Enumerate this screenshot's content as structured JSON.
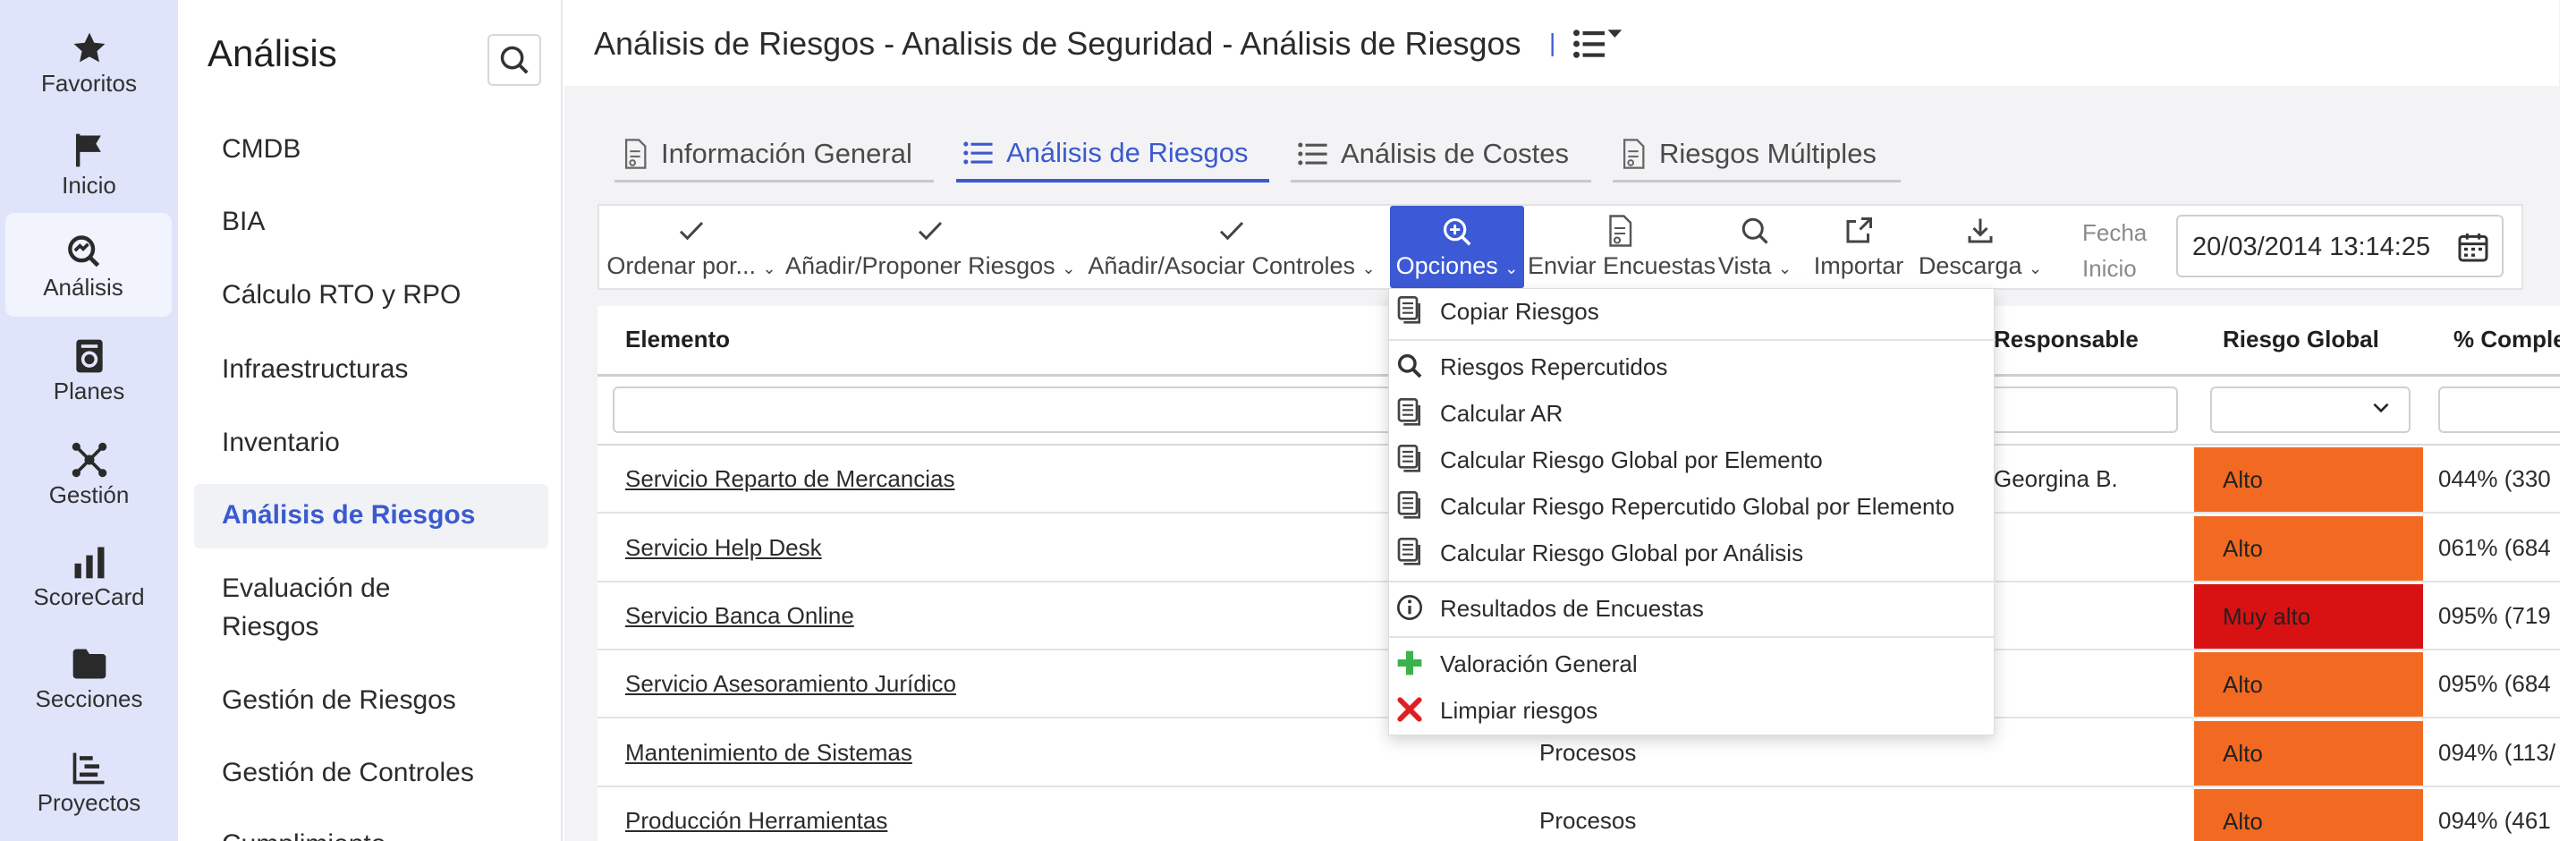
{
  "rail": {
    "items": [
      {
        "label": "Favoritos",
        "icon": "star-icon"
      },
      {
        "label": "Inicio",
        "icon": "flag-icon"
      },
      {
        "label": "Análisis",
        "icon": "analysis-icon",
        "active": true
      },
      {
        "label": "Planes",
        "icon": "plans-icon"
      },
      {
        "label": "Gestión",
        "icon": "network-icon"
      },
      {
        "label": "ScoreCard",
        "icon": "bar-chart-icon"
      },
      {
        "label": "Secciones",
        "icon": "folder-icon"
      },
      {
        "label": "Proyectos",
        "icon": "gantt-icon"
      }
    ]
  },
  "leftnav": {
    "title": "Análisis",
    "items": [
      "CMDB",
      "BIA",
      "Cálculo RTO y RPO",
      "Infraestructuras",
      "Inventario",
      "Análisis de Riesgos",
      "Evaluación de",
      "Riesgos",
      "Gestión de Riesgos",
      "Gestión de Controles",
      "Cumplimiento"
    ],
    "active": "Análisis de Riesgos"
  },
  "header": {
    "title": "Análisis de Riesgos  - Analisis de Seguridad - Análisis de Riesgos",
    "separator": "|"
  },
  "tabs": [
    {
      "label": "Información General",
      "icon": "document-icon"
    },
    {
      "label": "Análisis de Riesgos",
      "icon": "list-icon",
      "active": true
    },
    {
      "label": "Análisis de Costes",
      "icon": "list-icon"
    },
    {
      "label": "Riesgos Múltiples",
      "icon": "document-icon"
    }
  ],
  "toolbar": {
    "buttons": [
      {
        "label": "Ordenar por...",
        "icon": "check-icon"
      },
      {
        "label": "Añadir/Proponer Riesgos",
        "icon": "check-icon"
      },
      {
        "label": "Añadir/Asociar Controles",
        "icon": "check-icon"
      },
      {
        "label": "Opciones",
        "icon": "zoom-in-icon",
        "active": true
      },
      {
        "label": "Enviar Encuestas",
        "icon": "survey-icon"
      },
      {
        "label": "Vista",
        "icon": "search-icon"
      },
      {
        "label": "Importar",
        "icon": "import-icon"
      },
      {
        "label": "Descarga",
        "icon": "download-icon"
      }
    ],
    "fecha_label_1": "Fecha",
    "fecha_label_2": "Inicio",
    "fecha_value": "20/03/2014 13:14:25"
  },
  "table": {
    "headers": {
      "elemento": "Elemento",
      "responsable": "Responsable",
      "riesgo_global": "Riesgo Global",
      "completado": "% Comple"
    },
    "rows": [
      {
        "elemento": "Servicio Reparto de Mercancias",
        "tipo": "",
        "responsable": "Georgina B.",
        "riesgo": "Alto",
        "pct": "044% (330"
      },
      {
        "elemento": "Servicio Help Desk",
        "tipo": "",
        "responsable": "",
        "riesgo": "Alto",
        "pct": "061% (684"
      },
      {
        "elemento": "Servicio Banca Online",
        "tipo": "",
        "responsable": "",
        "riesgo": "Muy alto",
        "pct": "095% (719"
      },
      {
        "elemento": "Servicio Asesoramiento Jurídico",
        "tipo": "",
        "responsable": "",
        "riesgo": "Alto",
        "pct": "095% (684"
      },
      {
        "elemento": "Mantenimiento de Sistemas",
        "tipo": "Procesos",
        "responsable": "",
        "riesgo": "Alto",
        "pct": "094% (113/"
      },
      {
        "elemento": "Producción Herramientas",
        "tipo": "Procesos",
        "responsable": "",
        "riesgo": "Alto",
        "pct": "094% (461"
      }
    ]
  },
  "dropdown": {
    "items": [
      {
        "label": "Copiar Riesgos",
        "icon": "report-icon"
      },
      {
        "label": "Riesgos Repercutidos",
        "icon": "search-icon"
      },
      {
        "label": "Calcular AR",
        "icon": "report-icon"
      },
      {
        "label": "Calcular Riesgo Global por Elemento",
        "icon": "report-icon"
      },
      {
        "label": "Calcular Riesgo Repercutido Global por Elemento",
        "icon": "report-icon"
      },
      {
        "label": "Calcular Riesgo Global por Análisis",
        "icon": "report-icon"
      },
      {
        "label": "Resultados de Encuestas",
        "icon": "info-icon"
      },
      {
        "label": "Valoración General",
        "icon": "plus-icon"
      },
      {
        "label": "Limpiar riesgos",
        "icon": "close-icon"
      }
    ]
  },
  "colors": {
    "accent": "#3d5ad6",
    "risk_alto": "#f26a21",
    "risk_muy_alto": "#d81212",
    "plus_green": "#3bb34a",
    "close_red": "#e02020"
  }
}
